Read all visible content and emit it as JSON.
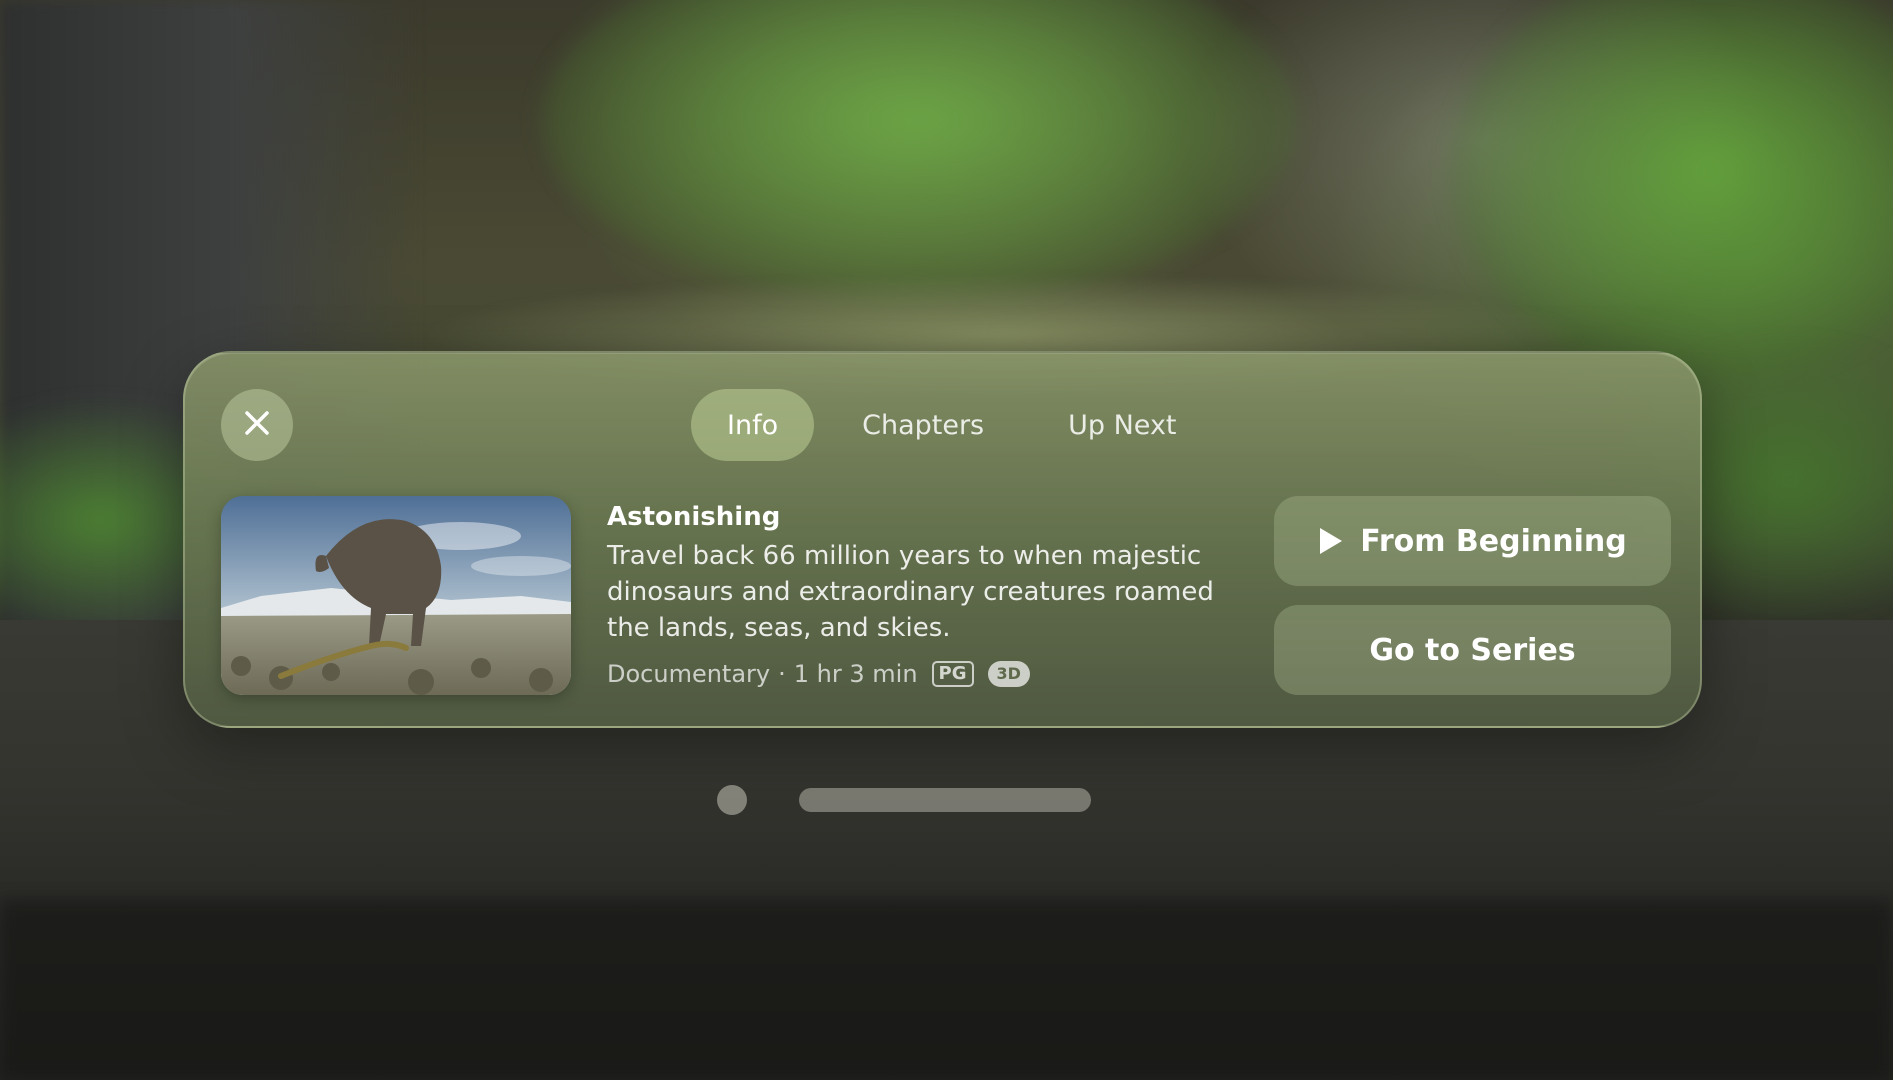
{
  "close": {
    "icon": "close-icon"
  },
  "tabs": [
    {
      "label": "Info",
      "active": true
    },
    {
      "label": "Chapters",
      "active": false
    },
    {
      "label": "Up Next",
      "active": false
    }
  ],
  "episode": {
    "title": "Astonishing",
    "description": "Travel back 66 million years to when majestic dinosaurs and extraordinary creatures roamed the lands, seas, and skies.",
    "genre": "Documentary",
    "separator": "·",
    "duration": "1 hr 3 min",
    "rating": "PG",
    "format": "3D"
  },
  "actions": {
    "from_beginning": "From Beginning",
    "go_to_series": "Go to Series"
  },
  "colors": {
    "panel": "#7a8660",
    "tab_active": "#b9c894",
    "button": "#a9b88f"
  }
}
